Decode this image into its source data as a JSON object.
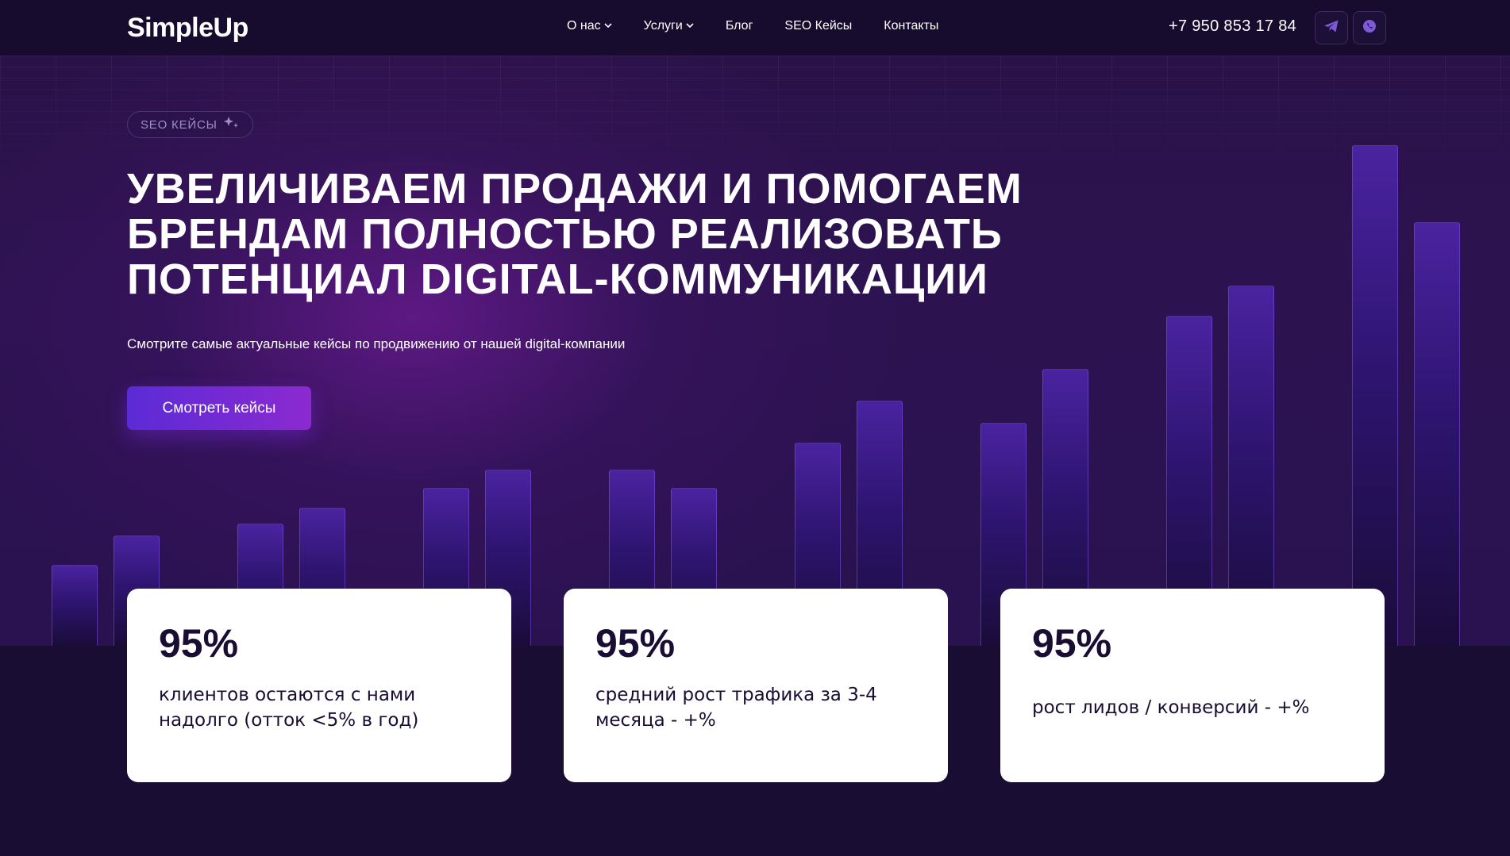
{
  "header": {
    "logo": "SimpleUp",
    "nav": [
      {
        "label": "О нас",
        "dropdown": true
      },
      {
        "label": "Услуги",
        "dropdown": true
      },
      {
        "label": "Блог",
        "dropdown": false
      },
      {
        "label": "SEO Кейсы",
        "dropdown": false
      },
      {
        "label": "Контакты",
        "dropdown": false
      }
    ],
    "phone": "+7 950 853 17 84",
    "social": [
      {
        "icon": "telegram-icon"
      },
      {
        "icon": "whatsapp-icon"
      }
    ]
  },
  "hero": {
    "badge": "SEO КЕЙСЫ",
    "headline_lines": [
      "УВЕЛИЧИВАЕМ ПРОДАЖИ И ПОМОГАЕМ",
      "БРЕНДАМ ПОЛНОСТЬЮ РЕАЛИЗОВАТЬ",
      "ПОТЕНЦИАЛ DIGITAL-КОММУНИКАЦИИ"
    ],
    "subtitle": "Смотрите самые актуальные кейсы по продвижению от нашей digital-компании",
    "cta_label": "Смотреть кейсы"
  },
  "stats": [
    {
      "value": "95%",
      "desc": "клиентов остаются с нами надолго (отток <5% в год)"
    },
    {
      "value": "95%",
      "desc": "средний рост трафика за 3-4 месяца - +%"
    },
    {
      "value": "95%",
      "desc": "рост лидов / конверсий - +%"
    }
  ],
  "colors": {
    "background": "#1a0d33",
    "accent_start": "#5b2bd6",
    "accent_end": "#8b2ad0",
    "card": "#ffffff"
  }
}
